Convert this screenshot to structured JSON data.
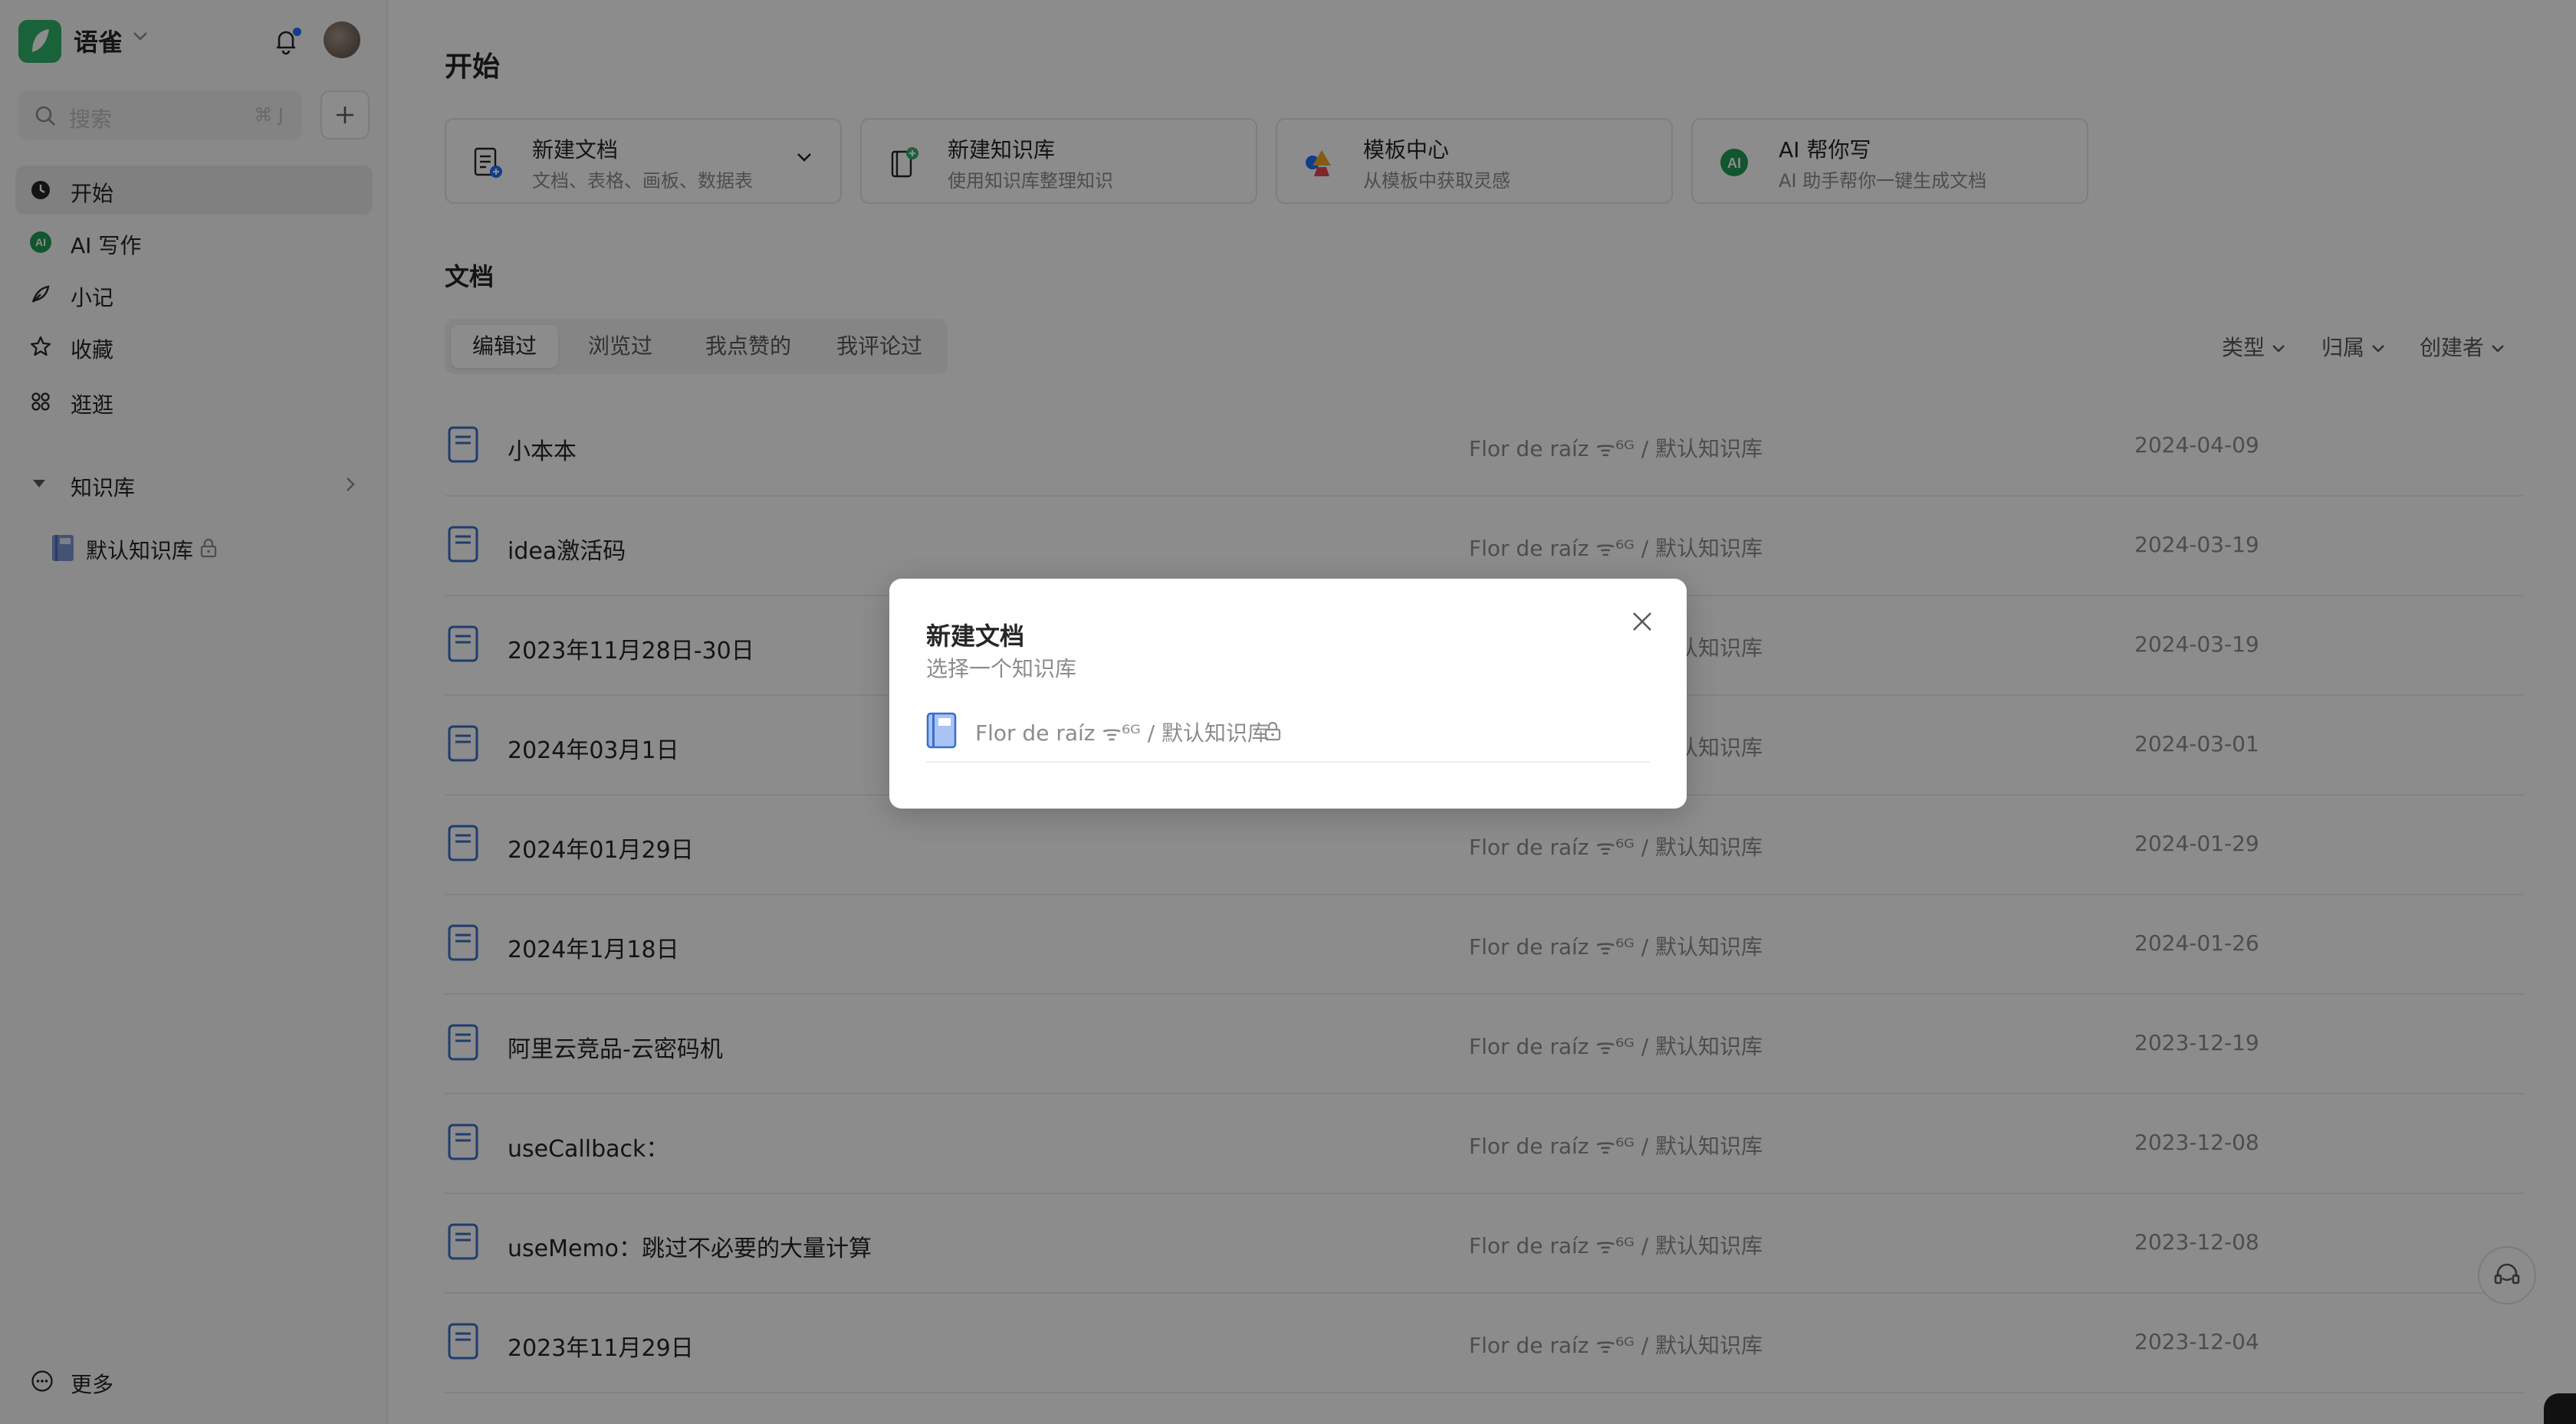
{
  "app": {
    "name": "语雀"
  },
  "search": {
    "placeholder": "搜索",
    "shortcut": "⌘ J"
  },
  "nav": [
    {
      "label": "开始",
      "icon": "clock-icon"
    },
    {
      "label": "AI 写作",
      "icon": "ai-icon"
    },
    {
      "label": "小记",
      "icon": "feather-icon"
    },
    {
      "label": "收藏",
      "icon": "star-icon"
    },
    {
      "label": "逛逛",
      "icon": "grid-icon"
    }
  ],
  "kb": {
    "header": "知识库",
    "item": "默认知识库"
  },
  "more": {
    "label": "更多"
  },
  "main": {
    "title": "开始",
    "cards": [
      {
        "title": "新建文档",
        "subtitle": "文档、表格、画板、数据表"
      },
      {
        "title": "新建知识库",
        "subtitle": "使用知识库整理知识"
      },
      {
        "title": "模板中心",
        "subtitle": "从模板中获取灵感"
      },
      {
        "title": "AI 帮你写",
        "subtitle": "AI 助手帮你一键生成文档"
      }
    ],
    "docs_title": "文档",
    "tabs": [
      "编辑过",
      "浏览过",
      "我点赞的",
      "我评论过"
    ],
    "filters": [
      "类型",
      "归属",
      "创建者"
    ],
    "docs": [
      {
        "title": "小本本",
        "kb": "Flor de raíz ᯤ⁶ᴳ / 默认知识库",
        "date": "2024-04-09"
      },
      {
        "title": "idea激活码",
        "kb": "Flor de raíz ᯤ⁶ᴳ / 默认知识库",
        "date": "2024-03-19"
      },
      {
        "title": "2023年11月28日-30日",
        "kb": "Flor de raíz ᯤ⁶ᴳ / 默认知识库",
        "date": "2024-03-19"
      },
      {
        "title": "2024年03月1日",
        "kb": "Flor de raíz ᯤ⁶ᴳ / 默认知识库",
        "date": "2024-03-01"
      },
      {
        "title": "2024年01月29日",
        "kb": "Flor de raíz ᯤ⁶ᴳ / 默认知识库",
        "date": "2024-01-29"
      },
      {
        "title": "2024年1月18日",
        "kb": "Flor de raíz ᯤ⁶ᴳ / 默认知识库",
        "date": "2024-01-26"
      },
      {
        "title": "阿里云竞品-云密码机",
        "kb": "Flor de raíz ᯤ⁶ᴳ / 默认知识库",
        "date": "2023-12-19"
      },
      {
        "title": "useCallback：",
        "kb": "Flor de raíz ᯤ⁶ᴳ / 默认知识库",
        "date": "2023-12-08"
      },
      {
        "title": "useMemo：跳过不必要的大量计算",
        "kb": "Flor de raíz ᯤ⁶ᴳ / 默认知识库",
        "date": "2023-12-08"
      },
      {
        "title": "2023年11月29日",
        "kb": "Flor de raíz ᯤ⁶ᴳ / 默认知识库",
        "date": "2023-12-04"
      }
    ]
  },
  "dialog": {
    "title": "新建文档",
    "subtitle": "选择一个知识库",
    "option": "Flor de raíz ᯤ⁶ᴳ / 默认知识库"
  },
  "colors": {
    "brand": "#31b36b",
    "accent": "#1e6fff",
    "overlay": "rgba(0,0,0,0.45)"
  }
}
